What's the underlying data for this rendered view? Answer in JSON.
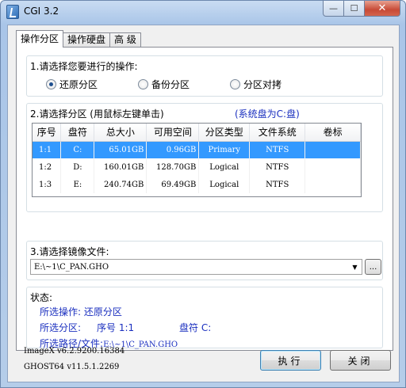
{
  "window": {
    "title": "CGI 3.2",
    "min": "—",
    "max": "☐",
    "close": "✕"
  },
  "tabs": [
    "操作分区",
    "操作硬盘",
    "高 级"
  ],
  "operation": {
    "label": "1.请选择您要进行的操作:",
    "options": [
      "还原分区",
      "备份分区",
      "分区对拷"
    ],
    "selected": 0
  },
  "partition": {
    "label": "2.请选择分区 (用鼠标左键单击)",
    "system_note": "(系统盘为C:盘)",
    "columns": [
      "序号",
      "盘符",
      "总大小",
      "可用空间",
      "分区类型",
      "文件系统",
      "卷标"
    ],
    "rows": [
      [
        "1:1",
        "C:",
        "65.01GB",
        "0.96GB",
        "Primary",
        "NTFS",
        ""
      ],
      [
        "1:2",
        "D:",
        "160.01GB",
        "128.70GB",
        "Logical",
        "NTFS",
        ""
      ],
      [
        "1:3",
        "E:",
        "240.74GB",
        "69.49GB",
        "Logical",
        "NTFS",
        ""
      ]
    ],
    "selected_row": 0
  },
  "image": {
    "label": "3.请选择镜像文件:",
    "value": "E:\\~1\\C_PAN.GHO",
    "browse": "..."
  },
  "status": {
    "label": "状态:",
    "op": "所选操作: 还原分区",
    "part_prefix": "所选分区:",
    "part_num": "序号 1:1",
    "part_drive": "盘符 C:",
    "path_prefix": "所选路径/文件:",
    "path_value": "E:\\~1\\C_PAN.GHO"
  },
  "versions": [
    "ImageX v6.2.9200.16384",
    "GHOST64 v11.5.1.2269"
  ],
  "buttons": {
    "execute": "执行",
    "close": "关闭"
  },
  "colors": {
    "accent": "#3399ff",
    "status_text": "#1a2fbf"
  }
}
